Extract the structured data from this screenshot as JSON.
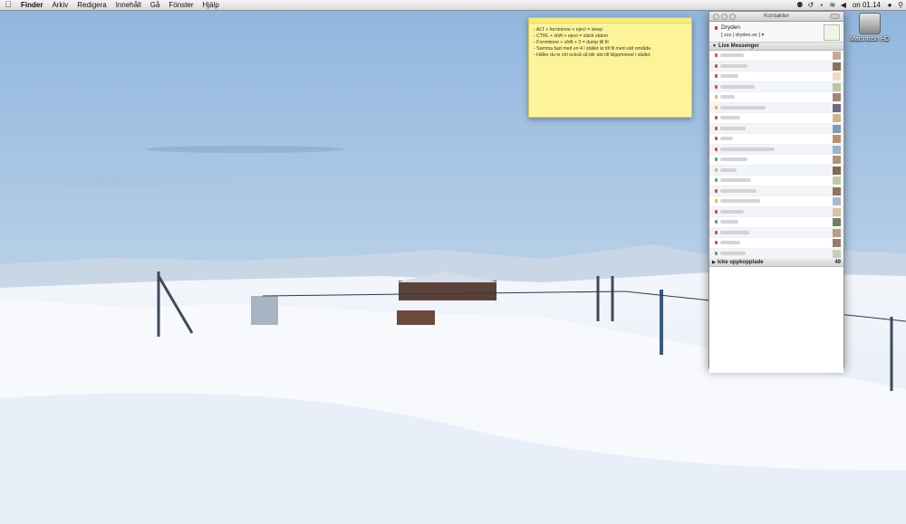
{
  "menubar": {
    "apple_icon": "apple-logo-icon",
    "app_name": "Finder",
    "items": [
      "Arkiv",
      "Redigera",
      "Innehåll",
      "Gå",
      "Fönster",
      "Hjälp"
    ],
    "clock": "on 01.14"
  },
  "desktop": {
    "drive_label": "Macintosh HD"
  },
  "sticky": {
    "lines": [
      "- ALT + fornminne + eject = sleep",
      "- CTRL + shift + eject = släck skärm",
      "- Fornminne + shift + 3 = dump till fil",
      "- Samma fast med en 4 i stället är till fil med valt område.",
      "- Håller du in ctrl också så blir det till klippminnet i stället."
    ]
  },
  "contacts": {
    "title": "Kontakter",
    "me_name": "Dryden",
    "me_message": "[ zzz | dryden.se ]",
    "group_online": "Live Messenger",
    "group_offline": "Icke uppkopplade",
    "offline_count": "49",
    "colors": {
      "busy": "#d34b57",
      "away": "#e0b84a",
      "online": "#5aa85a"
    }
  }
}
